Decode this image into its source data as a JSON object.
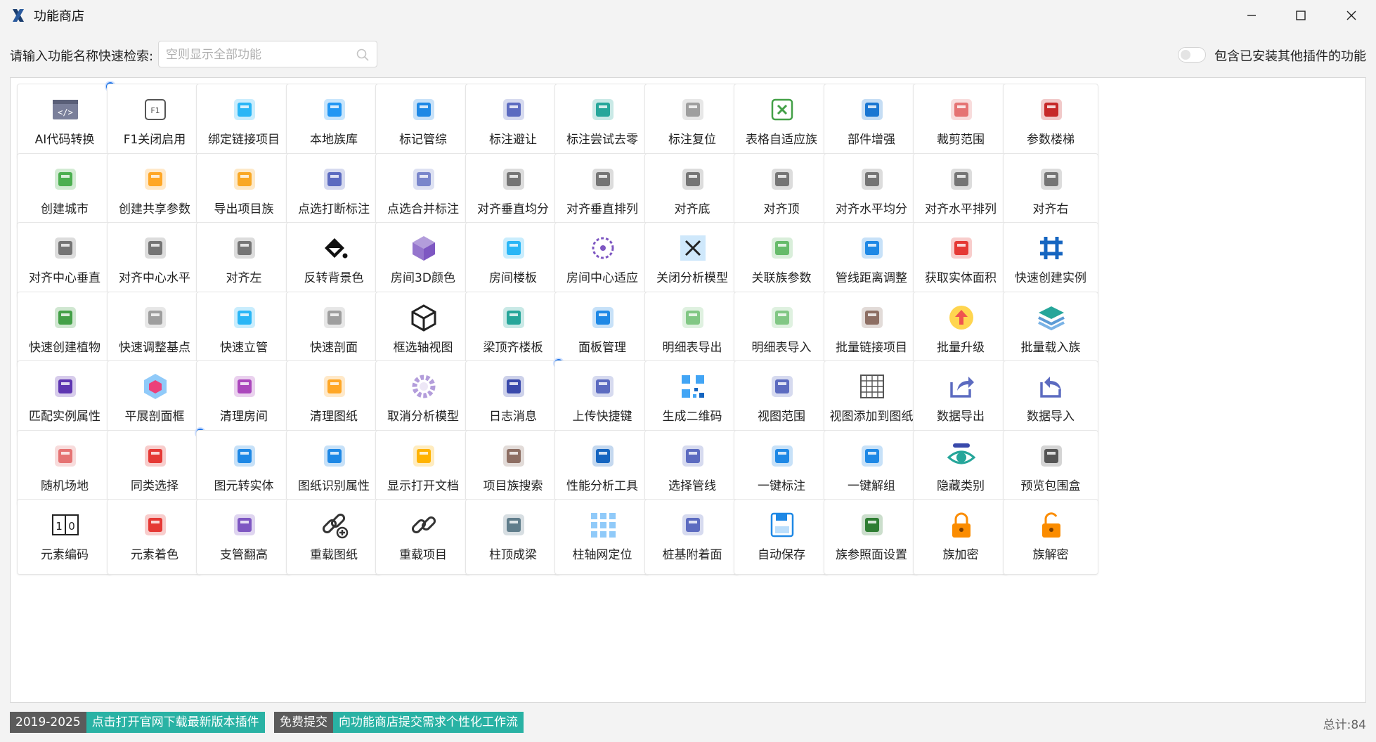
{
  "window": {
    "title": "功能商店"
  },
  "search": {
    "label": "请输入功能名称快速检索:",
    "placeholder": "空则显示全部功能",
    "value": ""
  },
  "toggle": {
    "label": "包含已安装其他插件的功能",
    "on": false
  },
  "tiles": [
    {
      "label": "AI代码转换",
      "icon": "code-icon",
      "color": "#7a7f9a",
      "dot": true
    },
    {
      "label": "F1关闭启用",
      "icon": "f1-key-icon",
      "color": "#555555"
    },
    {
      "label": "绑定链接项目",
      "icon": "link-blocks-icon",
      "color": "#29b6f6"
    },
    {
      "label": "本地族库",
      "icon": "database-icon",
      "color": "#2196f3"
    },
    {
      "label": "标记管综",
      "icon": "list-icon",
      "color": "#1e88e5"
    },
    {
      "label": "标注避让",
      "icon": "dimension-line-icon",
      "color": "#5c6bc0"
    },
    {
      "label": "标注尝试去零",
      "icon": "wave-icon",
      "color": "#26a69a"
    },
    {
      "label": "标注复位",
      "icon": "ruler-diagonal-icon",
      "color": "#9e9e9e"
    },
    {
      "label": "表格自适应族",
      "icon": "excel-x-icon",
      "color": "#43a047"
    },
    {
      "label": "部件增强",
      "icon": "box-icon",
      "color": "#1976d2"
    },
    {
      "label": "裁剪范围",
      "icon": "crop-scissors-icon",
      "color": "#e57373"
    },
    {
      "label": "参数楼梯",
      "icon": "stairs-icon",
      "color": "#c62828"
    },
    {
      "label": "创建城市",
      "icon": "map-icon",
      "color": "#4caf50"
    },
    {
      "label": "创建共享参数",
      "icon": "form-pencil-icon",
      "color": "#ffa726"
    },
    {
      "label": "导出项目族",
      "icon": "box-export-icon",
      "color": "#f9a825"
    },
    {
      "label": "点选打断标注",
      "icon": "break-line-icon",
      "color": "#5c6bc0"
    },
    {
      "label": "点选合并标注",
      "icon": "merge-line-icon",
      "color": "#7986cb"
    },
    {
      "label": "对齐垂直均分",
      "icon": "align-v-distribute-icon",
      "color": "#757575"
    },
    {
      "label": "对齐垂直排列",
      "icon": "align-v-arrange-icon",
      "color": "#757575"
    },
    {
      "label": "对齐底",
      "icon": "align-bottom-icon",
      "color": "#757575"
    },
    {
      "label": "对齐顶",
      "icon": "align-top-icon",
      "color": "#757575"
    },
    {
      "label": "对齐水平均分",
      "icon": "align-h-distribute-icon",
      "color": "#757575"
    },
    {
      "label": "对齐水平排列",
      "icon": "align-h-arrange-icon",
      "color": "#757575"
    },
    {
      "label": "对齐右",
      "icon": "align-right-icon",
      "color": "#757575"
    },
    {
      "label": "对齐中心垂直",
      "icon": "align-center-v-icon",
      "color": "#757575"
    },
    {
      "label": "对齐中心水平",
      "icon": "align-center-h-icon",
      "color": "#757575"
    },
    {
      "label": "对齐左",
      "icon": "align-left-icon",
      "color": "#757575"
    },
    {
      "label": "反转背景色",
      "icon": "paint-bucket-icon",
      "color": "#111111"
    },
    {
      "label": "房间3D颜色",
      "icon": "cube-3d-icon",
      "color": "#9575cd"
    },
    {
      "label": "房间楼板",
      "icon": "floor-plan-icon",
      "color": "#29b6f6"
    },
    {
      "label": "房间中心适应",
      "icon": "target-circle-icon",
      "color": "#7e57c2"
    },
    {
      "label": "关闭分析模型",
      "icon": "close-x-icon",
      "color": "#1565c0"
    },
    {
      "label": "关联族参数",
      "icon": "calculator-icon",
      "color": "#66bb6a"
    },
    {
      "label": "管线距离调整",
      "icon": "distance-arrow-icon",
      "color": "#1e88e5"
    },
    {
      "label": "获取实体面积",
      "icon": "area-hatch-icon",
      "color": "#e53935"
    },
    {
      "label": "快速创建实例",
      "icon": "grid-hash-icon",
      "color": "#1565c0"
    },
    {
      "label": "快速创建植物",
      "icon": "plant-icon",
      "color": "#43a047"
    },
    {
      "label": "快速调整基点",
      "icon": "axis-tripod-icon",
      "color": "#9e9e9e"
    },
    {
      "label": "快速立管",
      "icon": "pipe-icon",
      "color": "#29b6f6"
    },
    {
      "label": "快速剖面",
      "icon": "section-frame-icon",
      "color": "#9e9e9e"
    },
    {
      "label": "框选轴视图",
      "icon": "cube-outline-icon",
      "color": "#222222"
    },
    {
      "label": "梁顶齐楼板",
      "icon": "beam-align-icon",
      "color": "#26a69a"
    },
    {
      "label": "面板管理",
      "icon": "panel-manage-icon",
      "color": "#1e88e5"
    },
    {
      "label": "明细表导出",
      "icon": "excel-export-icon",
      "color": "#81c784"
    },
    {
      "label": "明细表导入",
      "icon": "excel-import-icon",
      "color": "#81c784"
    },
    {
      "label": "批量链接项目",
      "icon": "link-badge-icon",
      "color": "#8d6e63"
    },
    {
      "label": "批量升级",
      "icon": "upgrade-arrow-icon",
      "color": "#ef5350"
    },
    {
      "label": "批量载入族",
      "icon": "layers-icon",
      "color": "#26a69a"
    },
    {
      "label": "匹配实例属性",
      "icon": "brush-icon",
      "color": "#5e35b1"
    },
    {
      "label": "平展剖面框",
      "icon": "hex-box-icon",
      "color": "#ec407a"
    },
    {
      "label": "清理房间",
      "icon": "flask-icon",
      "color": "#ab47bc"
    },
    {
      "label": "清理图纸",
      "icon": "broom-icon",
      "color": "#ffa726"
    },
    {
      "label": "取消分析模型",
      "icon": "gear-icon",
      "color": "#b39ddb"
    },
    {
      "label": "日志消息",
      "icon": "log-file-icon",
      "color": "#3949ab",
      "dot": true
    },
    {
      "label": "上传快捷键",
      "icon": "keyboard-icon",
      "color": "#5c6bc0"
    },
    {
      "label": "生成二维码",
      "icon": "qr-code-icon",
      "color": "#42a5f5"
    },
    {
      "label": "视图范围",
      "icon": "view-scissors-icon",
      "color": "#5c6bc0"
    },
    {
      "label": "视图添加到图纸",
      "icon": "sheet-grid-icon",
      "color": "#555555"
    },
    {
      "label": "数据导出",
      "icon": "share-out-icon",
      "color": "#5c6bc0"
    },
    {
      "label": "数据导入",
      "icon": "share-in-icon",
      "color": "#5c6bc0"
    },
    {
      "label": "随机场地",
      "icon": "terrain-icon",
      "color": "#e57373"
    },
    {
      "label": "同类选择",
      "icon": "shapes-icon",
      "color": "#e53935",
      "dot": true
    },
    {
      "label": "图元转实体",
      "icon": "overlap-circles-icon",
      "color": "#1e88e5"
    },
    {
      "label": "图纸识别属性",
      "icon": "sheet-add-icon",
      "color": "#1e88e5"
    },
    {
      "label": "显示打开文档",
      "icon": "document-circle-icon",
      "color": "#ffb300"
    },
    {
      "label": "项目族搜索",
      "icon": "search-tag-icon",
      "color": "#8d6e63"
    },
    {
      "label": "性能分析工具",
      "icon": "file-search-icon",
      "color": "#1565c0"
    },
    {
      "label": "选择管线",
      "icon": "dashed-select-icon",
      "color": "#5c6bc0"
    },
    {
      "label": "一键标注",
      "icon": "ruler-pencil-icon",
      "color": "#1e88e5"
    },
    {
      "label": "一键解组",
      "icon": "ungroup-icon",
      "color": "#1e88e5"
    },
    {
      "label": "隐藏类别",
      "icon": "eye-icon",
      "color": "#26a69a"
    },
    {
      "label": "预览包围盒",
      "icon": "bounding-box-icon",
      "color": "#555555"
    },
    {
      "label": "元素编码",
      "icon": "binary-icon",
      "color": "#222222"
    },
    {
      "label": "元素着色",
      "icon": "color-palette-icon",
      "color": "#e53935"
    },
    {
      "label": "支管翻高",
      "icon": "pipe-raise-icon",
      "color": "#7e57c2"
    },
    {
      "label": "重载图纸",
      "icon": "chain-add-icon",
      "color": "#333333"
    },
    {
      "label": "重载项目",
      "icon": "chain-icon",
      "color": "#333333"
    },
    {
      "label": "柱顶成梁",
      "icon": "column-beam-icon",
      "color": "#607d8b"
    },
    {
      "label": "柱轴网定位",
      "icon": "grid-dots-icon",
      "color": "#90caf9"
    },
    {
      "label": "桩基附着面",
      "icon": "knot-icon",
      "color": "#5c6bc0"
    },
    {
      "label": "自动保存",
      "icon": "save-icon",
      "color": "#1e88e5"
    },
    {
      "label": "族参照面设置",
      "icon": "triangle-ruler-icon",
      "color": "#2e7d32"
    },
    {
      "label": "族加密",
      "icon": "lock-closed-icon",
      "color": "#fb8c00"
    },
    {
      "label": "族解密",
      "icon": "lock-open-icon",
      "color": "#fb8c00"
    }
  ],
  "footer": {
    "years": "2019-2025",
    "download_link": "点击打开官网下载最新版本插件",
    "free_submit": "免费提交",
    "request_link": "向功能商店提交需求个性化工作流",
    "total": "总计:84"
  },
  "colors": {
    "accent": "#1a73e8",
    "teal": "#29b2a4",
    "dark_pill": "#5b5b5b"
  }
}
